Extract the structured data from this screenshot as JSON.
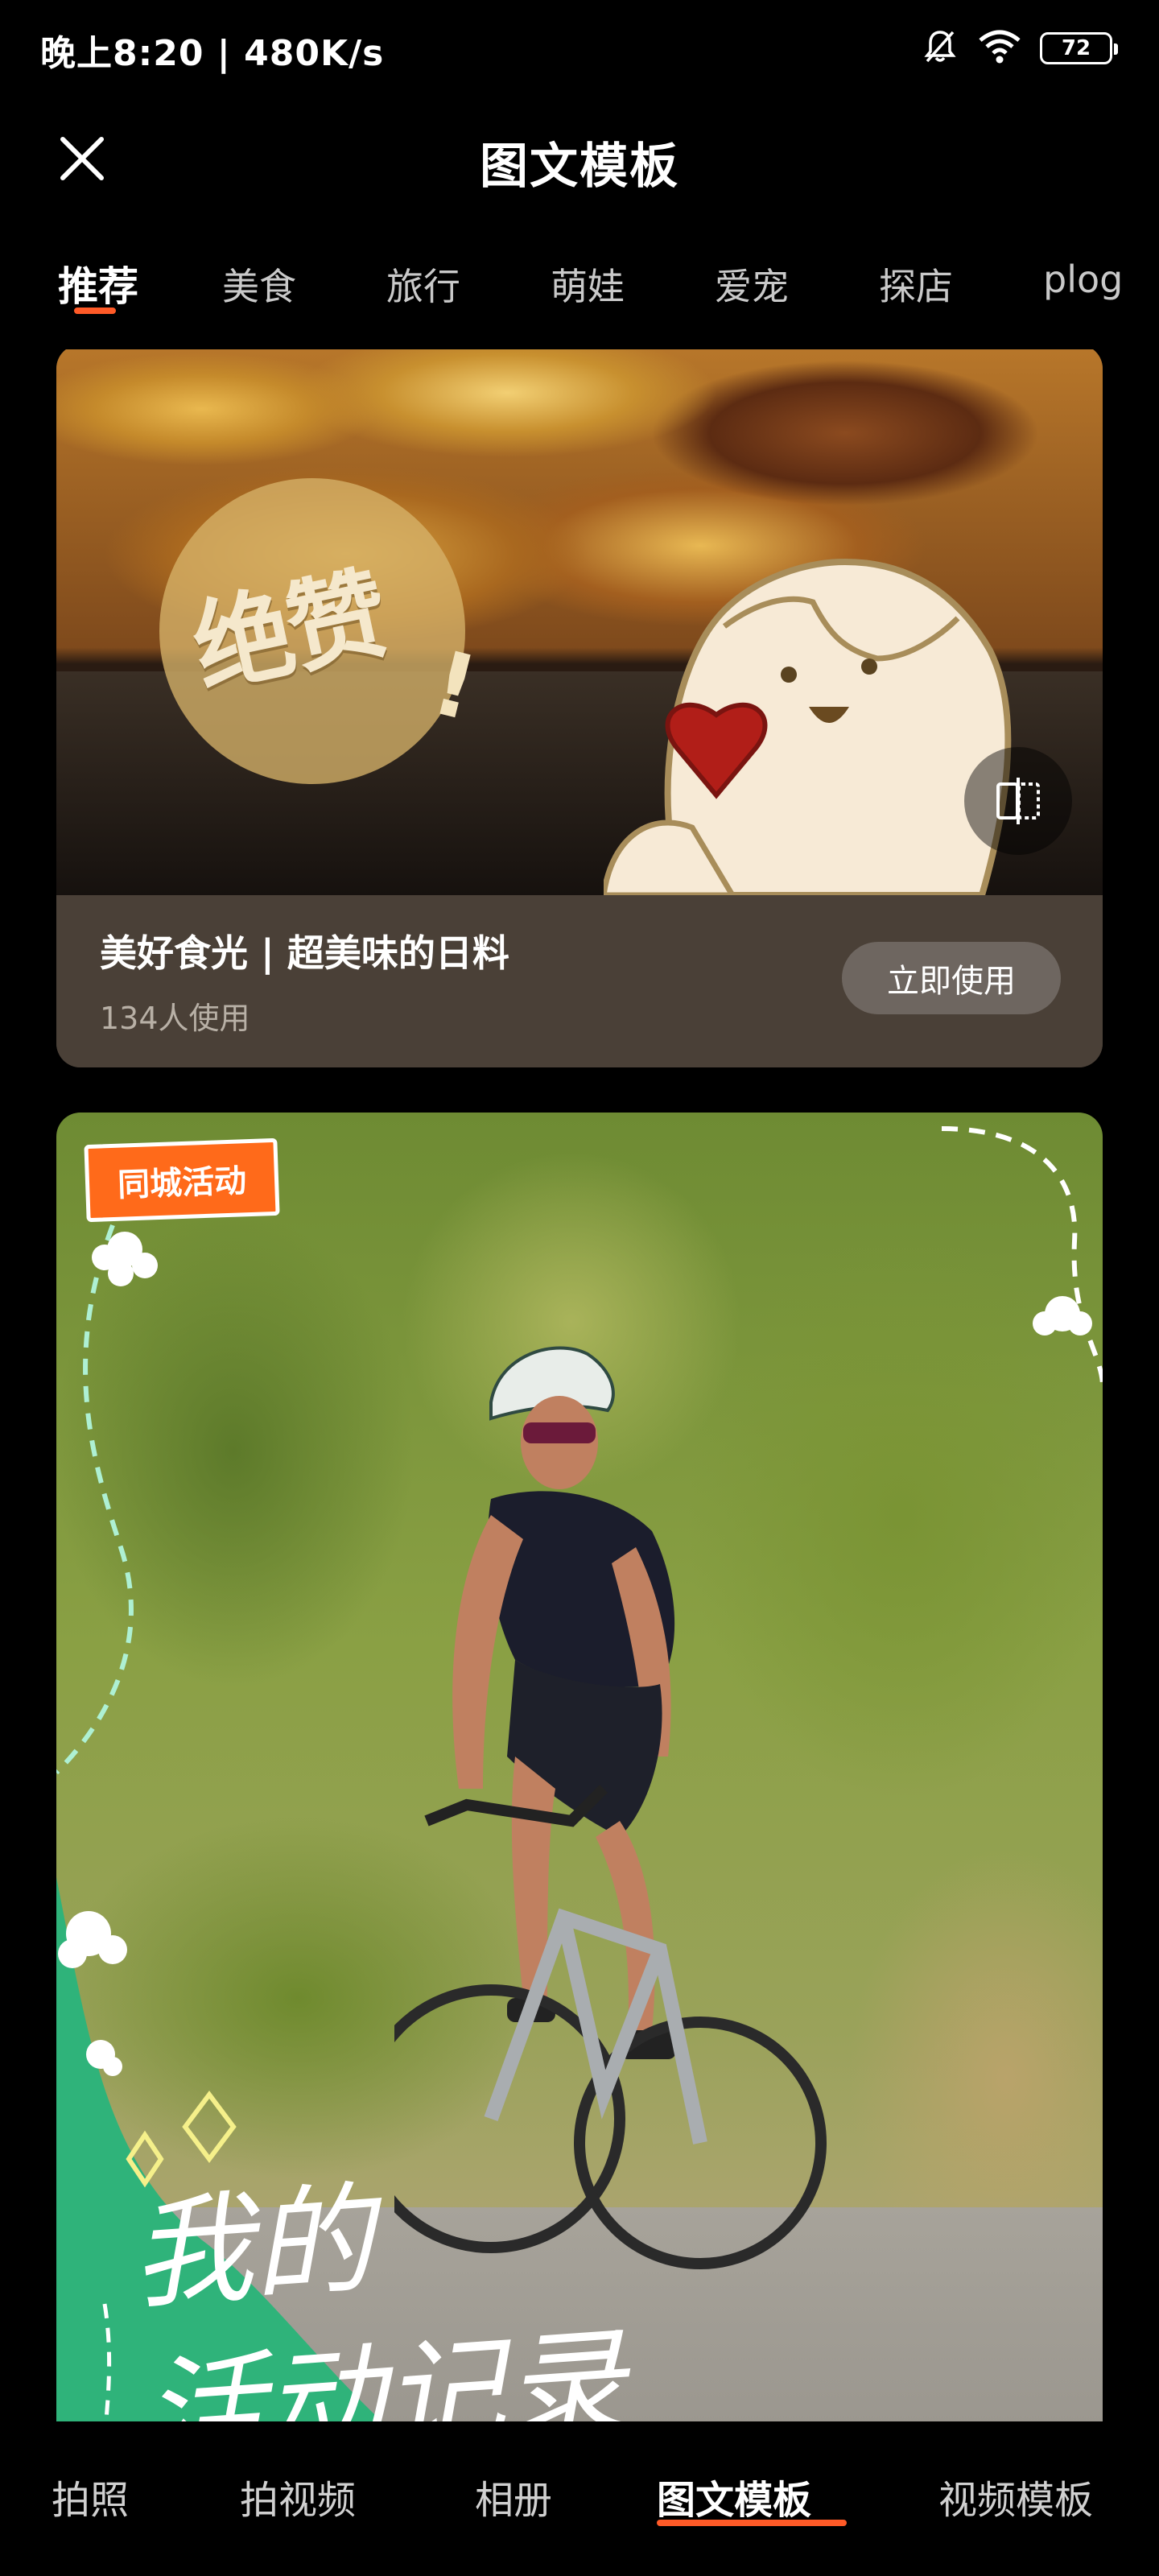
{
  "status_bar": {
    "time_speed": "晚上8:20 | 480K/s",
    "battery": "72",
    "icons": [
      "bell-muted-icon",
      "wifi-icon",
      "battery-icon"
    ]
  },
  "header": {
    "title": "图文模板",
    "close_icon": "close-icon"
  },
  "tabs": [
    {
      "label": "推荐",
      "active": true
    },
    {
      "label": "美食",
      "active": false
    },
    {
      "label": "旅行",
      "active": false
    },
    {
      "label": "萌娃",
      "active": false
    },
    {
      "label": "爱宠",
      "active": false
    },
    {
      "label": "探店",
      "active": false
    },
    {
      "label": "plog",
      "active": false
    }
  ],
  "cards": [
    {
      "image_text_main": "绝赞",
      "image_text_mark": "!",
      "title": "美好食光 | 超美味的日料",
      "usage": "134人使用",
      "button": "立即使用",
      "compare_icon": "compare-icon"
    },
    {
      "tag": "同城活动",
      "slogan_line1": "我的",
      "slogan_line2": "活动记录"
    }
  ],
  "bottom_nav": [
    {
      "label": "拍照",
      "active": false
    },
    {
      "label": "拍视频",
      "active": false
    },
    {
      "label": "相册",
      "active": false
    },
    {
      "label": "图文模板",
      "active": true
    },
    {
      "label": "视频模板",
      "active": false
    }
  ],
  "colors": {
    "accent": "#ff5a27",
    "card_info_bg": "#4a4037",
    "tag_orange": "#ff6a1a",
    "template_green": "#2fb37a"
  }
}
